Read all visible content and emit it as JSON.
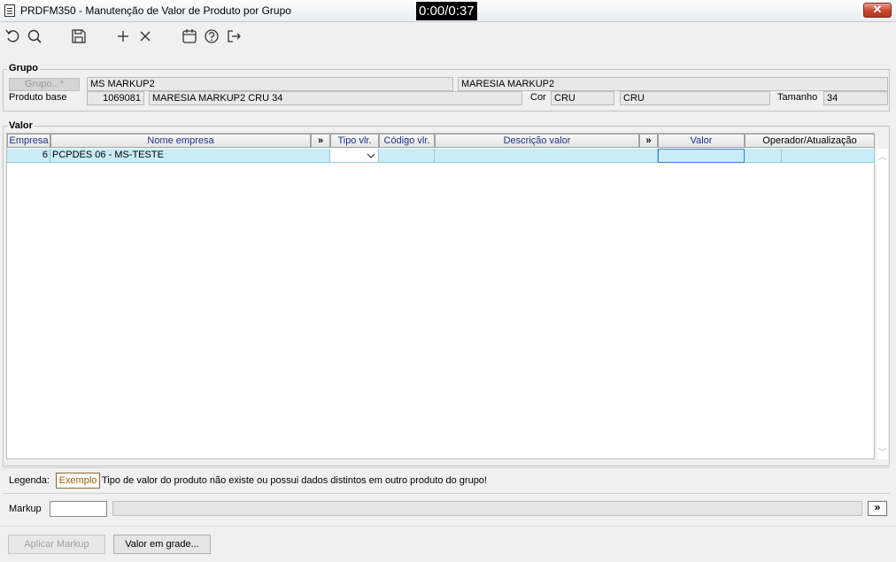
{
  "window": {
    "title": "PRDFM350 - Manutenção de Valor de Produto por Grupo",
    "timer": "0:00/0:37",
    "close_label": "✕"
  },
  "toolbar": {
    "icons": [
      "undo-icon",
      "search-icon",
      "save-icon",
      "add-icon",
      "delete-icon",
      "calendar-icon",
      "help-icon",
      "exit-icon"
    ]
  },
  "grupo": {
    "legend": "Grupo",
    "grupo_button": "Grupo.. *",
    "grupo_code": "MS MARKUP2",
    "grupo_desc": "MARESIA MARKUP2",
    "produto_base_label": "Produto base",
    "produto_code": "1069081",
    "produto_desc": "MARESIA MARKUP2 CRU 34",
    "cor_label": "Cor",
    "cor_code": "CRU",
    "cor_desc": "CRU",
    "tamanho_label": "Tamanho",
    "tamanho_value": "34"
  },
  "valor": {
    "legend": "Valor",
    "columns": {
      "empresa": "Empresa",
      "nome_empresa": "Nome empresa",
      "expand1": "»",
      "tipo_vlr": "Tipo vlr.",
      "codigo_vlr": "Código vlr.",
      "descricao_valor": "Descrição valor",
      "expand2": "»",
      "valor": "Valor",
      "operador": "Operador/Atualização"
    },
    "rows": [
      {
        "empresa": "6",
        "nome_empresa": "PCPDES 06 - MS-TESTE",
        "tipo_vlr": "",
        "codigo_vlr": "",
        "descricao_valor": "",
        "valor": "",
        "operador": ""
      }
    ]
  },
  "legenda": {
    "label": "Legenda:",
    "exemplo": "Exemplo",
    "text": "Tipo de valor do produto não existe ou possui dados distintos em outro produto do grupo!"
  },
  "markup": {
    "label": "Markup",
    "value": "",
    "more_label": "»"
  },
  "buttons": {
    "aplicar_markup": "Aplicar Markup",
    "valor_em_grade": "Valor em grade..."
  },
  "colors": {
    "selected_row": "#c9ecf7",
    "header_text": "#1f2f8a",
    "close_button": "#c8442c"
  }
}
